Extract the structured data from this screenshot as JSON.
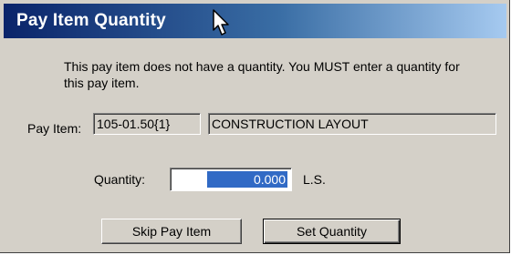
{
  "window": {
    "title": "Pay Item Quantity"
  },
  "message": "This pay item does not have a quantity.  You MUST enter a quantity for this pay item.",
  "pay_item": {
    "label": "Pay Item:",
    "number": "105-01.50{1}",
    "description": "CONSTRUCTION LAYOUT"
  },
  "quantity": {
    "label": "Quantity:",
    "value": "0.000",
    "unit": "L.S."
  },
  "buttons": {
    "skip": "Skip Pay Item",
    "set": "Set Quantity"
  },
  "colors": {
    "titlebar_start": "#0a246a",
    "titlebar_end": "#a6caf0",
    "selection": "#316ac5",
    "dialog_face": "#d4d0c8"
  },
  "icons": {
    "cursor": "mouse-pointer-icon"
  }
}
